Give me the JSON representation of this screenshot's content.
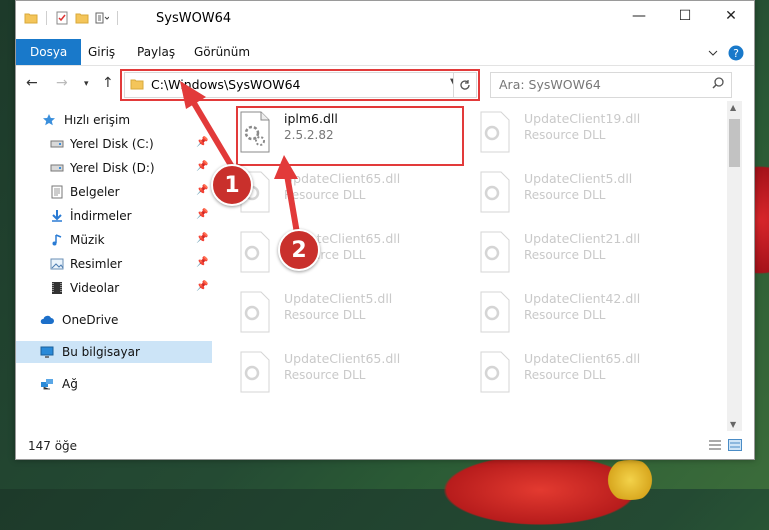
{
  "window": {
    "title": "SysWOW64",
    "controls": {
      "minimize": "—",
      "maximize": "☐",
      "close": "✕"
    }
  },
  "ribbon": {
    "tabs": [
      "Dosya",
      "Giriş",
      "Paylaş",
      "Görünüm"
    ],
    "active_tab": "Dosya"
  },
  "nav": {
    "address": "C:\\Windows\\SysWOW64",
    "search_placeholder": "Ara: SysWOW64"
  },
  "sidebar": {
    "items": [
      {
        "label": "Hızlı erişim",
        "icon": "star-icon",
        "pinned": false
      },
      {
        "label": "Yerel Disk (C:)",
        "icon": "drive-icon",
        "pinned": true
      },
      {
        "label": "Yerel Disk (D:)",
        "icon": "drive-icon",
        "pinned": true
      },
      {
        "label": "Belgeler",
        "icon": "documents-icon",
        "pinned": true
      },
      {
        "label": "İndirmeler",
        "icon": "download-icon",
        "pinned": true
      },
      {
        "label": "Müzik",
        "icon": "music-icon",
        "pinned": true
      },
      {
        "label": "Resimler",
        "icon": "pictures-icon",
        "pinned": true
      },
      {
        "label": "Videolar",
        "icon": "videos-icon",
        "pinned": true
      },
      {
        "label": "OneDrive",
        "icon": "cloud-icon",
        "pinned": false
      },
      {
        "label": "Bu bilgisayar",
        "icon": "computer-icon",
        "pinned": false,
        "selected": true
      },
      {
        "label": "Ağ",
        "icon": "network-icon",
        "pinned": false
      }
    ]
  },
  "files": [
    {
      "name": "iplm6.dll",
      "detail": "2.5.2.82",
      "highlighted": true
    },
    {
      "name": "UpdateClient19.dll",
      "detail": "Resource DLL"
    },
    {
      "name": "UpdateClient65.dll",
      "detail": "Resource DLL"
    },
    {
      "name": "UpdateClient5.dll",
      "detail": "Resource DLL"
    },
    {
      "name": "UpdateClient65.dll",
      "detail": "Resource DLL"
    },
    {
      "name": "UpdateClient21.dll",
      "detail": "Resource DLL"
    },
    {
      "name": "UpdateClient5.dll",
      "detail": "Resource DLL"
    },
    {
      "name": "UpdateClient42.dll",
      "detail": "Resource DLL"
    },
    {
      "name": "UpdateClient65.dll",
      "detail": "Resource DLL"
    },
    {
      "name": "UpdateClient65.dll",
      "detail": "Resource DLL"
    }
  ],
  "status": {
    "item_count": "147 öğe"
  },
  "annotations": {
    "step1": "1",
    "step2": "2"
  },
  "colors": {
    "accent": "#1979ca",
    "highlight_border": "#e23a3a",
    "badge": "#c9302c"
  }
}
